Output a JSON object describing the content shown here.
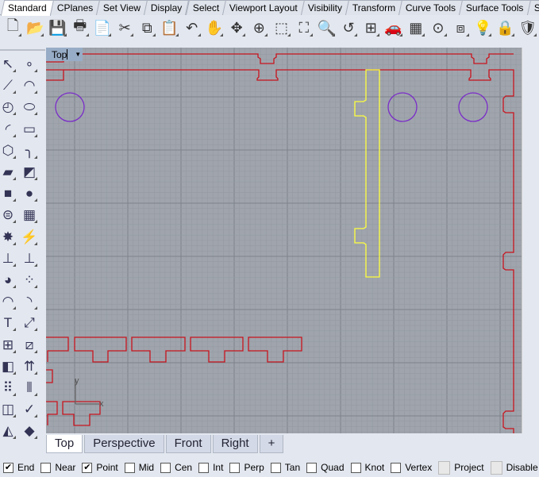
{
  "toolbar_tabs": [
    "Standard",
    "CPlanes",
    "Set View",
    "Display",
    "Select",
    "Viewport Layout",
    "Visibility",
    "Transform",
    "Curve Tools",
    "Surface Tools",
    "So"
  ],
  "active_toolbar_tab": "Standard",
  "toolbar_icons": [
    {
      "name": "new-icon",
      "glyph": "🗋"
    },
    {
      "name": "open-icon",
      "glyph": "📂"
    },
    {
      "name": "save-icon",
      "glyph": "💾"
    },
    {
      "name": "print-icon",
      "glyph": "🖶"
    },
    {
      "name": "import-icon",
      "glyph": "📄"
    },
    {
      "name": "cut-icon",
      "glyph": "✂"
    },
    {
      "name": "copy-icon",
      "glyph": "⧉"
    },
    {
      "name": "paste-icon",
      "glyph": "📋"
    },
    {
      "name": "undo-icon",
      "glyph": "↶"
    },
    {
      "name": "pan-icon",
      "glyph": "✋"
    },
    {
      "name": "rotate-view-icon",
      "glyph": "✥"
    },
    {
      "name": "zoom-icon",
      "glyph": "⊕"
    },
    {
      "name": "zoom-window-icon",
      "glyph": "⬚"
    },
    {
      "name": "zoom-extents-icon",
      "glyph": "⛶"
    },
    {
      "name": "zoom-selected-icon",
      "glyph": "🔍"
    },
    {
      "name": "undo-view-icon",
      "glyph": "↺"
    },
    {
      "name": "four-viewports-icon",
      "glyph": "⊞"
    },
    {
      "name": "car-icon",
      "glyph": "🚗"
    },
    {
      "name": "cplane-icon",
      "glyph": "▦"
    },
    {
      "name": "osnap-icon",
      "glyph": "⊙"
    },
    {
      "name": "object-properties-icon",
      "glyph": "⧈"
    },
    {
      "name": "light-bulb-icon",
      "glyph": "💡"
    },
    {
      "name": "lock-icon",
      "glyph": "🔒"
    },
    {
      "name": "render-icon",
      "glyph": "🛡"
    }
  ],
  "left_tools": [
    "select-icon",
    "point-icon",
    "polyline-icon",
    "curve-icon",
    "circle-icon",
    "ellipse-icon",
    "arc-icon",
    "rectangle-icon",
    "polygon-icon",
    "fillet-icon",
    "surface-corners-icon",
    "extrude-surface-icon",
    "box-icon",
    "sphere-icon",
    "cylinder-icon",
    "mesh-icon",
    "boolean-union-icon",
    "explode-icon",
    "trim-icon",
    "split-icon",
    "group-icon",
    "ungroup-icon",
    "curve-from-object-icon",
    "offset-icon",
    "text-icon",
    "move-icon",
    "array-icon",
    "orient-icon",
    "solid-edit-icon",
    "gumball-icon",
    "polar-array-icon",
    "align-icon",
    "analyze-icon",
    "check-icon",
    "render-shaded-icon",
    "render-mode-icon"
  ],
  "left_glyphs": [
    "↖",
    "∘",
    "⟋",
    "◠",
    "◴",
    "⬭",
    "◜",
    "▭",
    "⬡",
    "╮",
    "▰",
    "◩",
    "■",
    "●",
    "⊜",
    "▦",
    "✸",
    "⚡",
    "⊥",
    "⊥",
    "◕",
    "⁘",
    "◠",
    "◝",
    "T",
    "⤢",
    "⊞",
    "⧄",
    "◧",
    "⇈",
    "⠿",
    "⦀",
    "◫",
    "✓",
    "◭",
    "◆"
  ],
  "viewport": {
    "label": "Top",
    "dropdown_glyph": "▼"
  },
  "axis": {
    "x": "x",
    "y": "y"
  },
  "viewport_tabs": [
    {
      "label": "Top",
      "active": true
    },
    {
      "label": "Perspective"
    },
    {
      "label": "Front"
    },
    {
      "label": "Right"
    },
    {
      "label": "+"
    }
  ],
  "osnaps": [
    {
      "label": "End",
      "checked": true
    },
    {
      "label": "Near",
      "checked": false
    },
    {
      "label": "Point",
      "checked": true
    },
    {
      "label": "Mid",
      "checked": false
    },
    {
      "label": "Cen",
      "checked": false
    },
    {
      "label": "Int",
      "checked": false
    },
    {
      "label": "Perp",
      "checked": false
    },
    {
      "label": "Tan",
      "checked": false
    },
    {
      "label": "Quad",
      "checked": false
    },
    {
      "label": "Knot",
      "checked": false
    },
    {
      "label": "Vertex",
      "checked": false
    },
    {
      "label": "Project",
      "checked": false,
      "disabled": true
    },
    {
      "label": "Disable",
      "checked": false,
      "disabled": true
    }
  ],
  "colors": {
    "curve": "#c8141e",
    "circle": "#7a2cc8",
    "selected": "#ffff3c",
    "grid": "#a0a5ad"
  }
}
